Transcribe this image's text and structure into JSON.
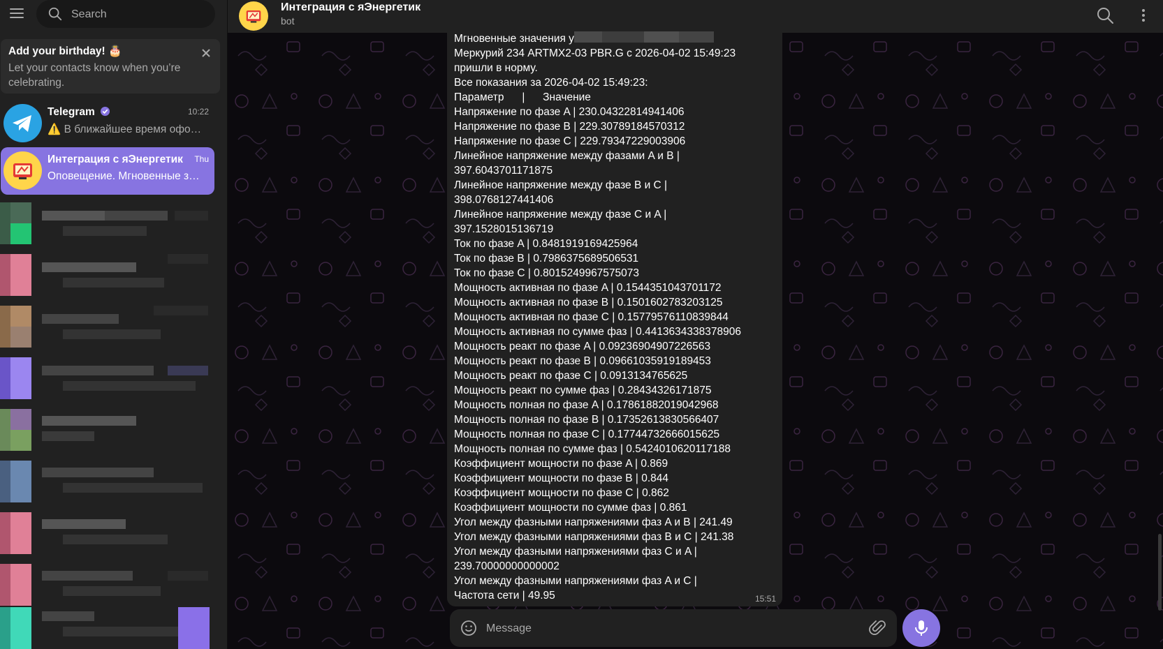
{
  "sidebar": {
    "search": {
      "placeholder": "Search"
    },
    "birthday": {
      "title": "Add your birthday! 🎂",
      "text": "Let your contacts know when you’re celebrating."
    },
    "chats": [
      {
        "name": "Telegram",
        "time": "10:22",
        "preview": "⚠️ В ближайшее время офо…",
        "verified": true,
        "icon": "telegram-plane-icon"
      },
      {
        "name": "Интеграция с яЭнергетик",
        "time": "Thu",
        "preview": "Оповещение. Мгновенные з…",
        "icon": "bot-logo-icon",
        "active": true
      }
    ],
    "blurred_chat_count": 8
  },
  "header": {
    "title": "Интеграция с яЭнергетик",
    "status": "bot",
    "icons": [
      "search-icon",
      "more-vertical-icon"
    ]
  },
  "message": {
    "time": "15:51",
    "lines": [
      "Мгновенные значения у",
      "Меркурий 234 ARTMX2-03 PBR.G с 2026-04-02 15:49:23",
      "пришли в норму.",
      "Все показания за 2026-04-02 15:49:23:",
      "Параметр      |      Значение",
      "Напряжение по фазе A | 230.04322814941406",
      "Напряжение по фазе B | 229.30789184570312",
      "Напряжение по фазе C | 229.79347229003906",
      "Линейное напряжение между фазами A и B |",
      "397.6043701171875",
      "Линейное напряжение между фазе B и C |",
      "398.0768127441406",
      "Линейное напряжение между фазе C и A |",
      "397.1528015136719",
      "Ток по фазе A | 0.8481919169425964",
      "Ток по фазе B | 0.7986375689506531",
      "Ток по фазе C | 0.8015249967575073",
      "Мощность активная по фазе A | 0.1544351043701172",
      "Мощность активная по фазе B | 0.1501602783203125",
      "Мощность активная по фазе C | 0.15779576110839844",
      "Мощность активная по сумме фаз | 0.4413634338378906",
      "Мощность реакт по фазе A | 0.09236904907226563",
      "Мощность реакт по фазе B | 0.09661035919189453",
      "Мощность реакт по фазе C | 0.0913134765625",
      "Мощность реакт по сумме фаз | 0.28434326171875",
      "Мощность полная по фазе A | 0.17861882019042968",
      "Мощность полная по фазе B | 0.17352613830566407",
      "Мощность полная по фазе C | 0.17744732666015625",
      "Мощность полная по сумме фаз | 0.5424010620117188",
      "Коэффициент мощности по фазе A | 0.869",
      "Коэффициент мощности по фазе B | 0.844",
      "Коэффициент мощности по фазе C | 0.862",
      "Коэффициент мощности по сумме фаз | 0.861",
      "Угол между фазными напряжениями фаз A и B | 241.49",
      "Угол между фазными напряжениями фаз B и C | 241.38",
      "Угол между фазными напряжениями фаз C и A |",
      "239.70000000000002",
      "Угол между фазными напряжениями фаз A и C |",
      "Частота сети | 49.95"
    ]
  },
  "composer": {
    "placeholder": "Message"
  },
  "colors": {
    "accent": "#8774e1",
    "sidebar_bg": "#212121",
    "chat_bg": "#0c0a0e",
    "muted_text": "#aaaaaa",
    "verified": "#8774e1",
    "telegram_blue": "#2aa3e3"
  }
}
